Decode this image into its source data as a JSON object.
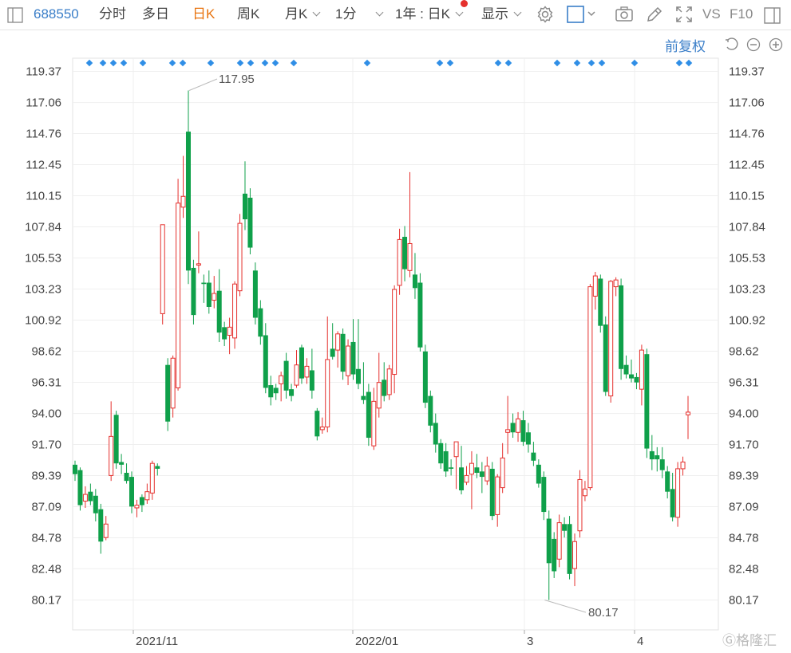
{
  "toolbar": {
    "stock_code": "688550",
    "tabs": [
      {
        "label": "分时"
      },
      {
        "label": "多日"
      },
      {
        "label": "日K",
        "active": true
      },
      {
        "label": "周K"
      },
      {
        "label": "月K"
      },
      {
        "label": "1分"
      }
    ],
    "period_select": "1年 : 日K",
    "display_label": "显示",
    "right_labels": [
      "VS",
      "F10"
    ],
    "accent_color": "#e8730e",
    "link_color": "#3a7ec8"
  },
  "subbar": {
    "fuquan_label": "前复权"
  },
  "watermark": "格隆汇",
  "chart_data": {
    "type": "candlestick",
    "yticks": [
      "119.37",
      "117.06",
      "114.76",
      "112.45",
      "110.15",
      "107.84",
      "105.53",
      "103.23",
      "100.92",
      "98.62",
      "96.31",
      "94.00",
      "91.70",
      "89.39",
      "87.09",
      "84.78",
      "82.48",
      "80.17"
    ],
    "ylim": [
      80.17,
      119.37
    ],
    "xlabels": [
      "2021/11",
      "2022/01",
      "3",
      "4"
    ],
    "high_annotation": "117.95",
    "low_annotation": "80.17",
    "up_color": "#e5302d",
    "down_color": "#0fa04a",
    "marker_color": "#2f8ee6",
    "candles": [
      [
        90.2,
        89.5,
        90.5,
        89.0
      ],
      [
        89.8,
        87.2,
        90.0,
        86.8
      ],
      [
        87.5,
        88.0,
        88.6,
        87.0
      ],
      [
        88.2,
        87.5,
        88.8,
        87.2
      ],
      [
        87.9,
        86.6,
        88.4,
        86.0
      ],
      [
        86.9,
        84.5,
        87.3,
        83.6
      ],
      [
        84.8,
        85.8,
        86.4,
        84.6
      ],
      [
        89.4,
        92.3,
        94.9,
        89.0
      ],
      [
        93.9,
        90.3,
        94.2,
        89.9
      ],
      [
        90.4,
        90.2,
        91.0,
        89.5
      ],
      [
        89.6,
        89.0,
        90.3,
        88.8
      ],
      [
        89.3,
        87.1,
        89.7,
        86.6
      ],
      [
        87.0,
        87.2,
        87.6,
        86.3
      ],
      [
        87.8,
        87.2,
        88.0,
        86.7
      ],
      [
        87.6,
        88.2,
        88.8,
        87.3
      ],
      [
        88.1,
        90.3,
        90.5,
        87.6
      ],
      [
        90.1,
        89.9,
        90.3,
        89.4
      ],
      [
        101.4,
        108.0,
        108.0,
        100.6
      ],
      [
        97.6,
        93.4,
        98.1,
        92.7
      ],
      [
        94.4,
        98.1,
        98.3,
        93.7
      ],
      [
        95.9,
        109.6,
        111.4,
        95.7
      ],
      [
        109.3,
        110.1,
        113.1,
        108.5
      ],
      [
        114.9,
        104.6,
        117.95,
        103.6
      ],
      [
        104.8,
        101.3,
        105.4,
        100.6
      ],
      [
        105.0,
        105.1,
        107.5,
        104.4
      ],
      [
        103.7,
        103.6,
        104.3,
        102.2
      ],
      [
        103.7,
        101.9,
        104.6,
        101.4
      ],
      [
        102.4,
        102.9,
        104.2,
        101.8
      ],
      [
        103.1,
        100.0,
        104.7,
        99.3
      ],
      [
        100.4,
        99.5,
        100.8,
        99.0
      ],
      [
        99.8,
        100.4,
        101.1,
        98.4
      ],
      [
        99.6,
        103.6,
        103.8,
        98.8
      ],
      [
        103.1,
        108.1,
        108.8,
        102.7
      ],
      [
        110.3,
        108.4,
        112.7,
        107.6
      ],
      [
        110.0,
        106.3,
        110.7,
        105.8
      ],
      [
        104.6,
        101.1,
        105.2,
        100.6
      ],
      [
        101.8,
        99.7,
        102.4,
        99.1
      ],
      [
        99.8,
        95.9,
        100.7,
        95.5
      ],
      [
        96.1,
        95.2,
        96.8,
        94.6
      ],
      [
        95.9,
        95.5,
        96.2,
        95.0
      ],
      [
        96.2,
        96.8,
        97.1,
        94.9
      ],
      [
        97.9,
        95.7,
        98.5,
        95.1
      ],
      [
        95.8,
        95.3,
        96.2,
        94.9
      ],
      [
        96.1,
        97.6,
        98.7,
        95.9
      ],
      [
        98.9,
        96.6,
        99.1,
        96.2
      ],
      [
        96.7,
        97.5,
        98.1,
        96.2
      ],
      [
        97.2,
        95.7,
        98.8,
        95.1
      ],
      [
        94.2,
        92.3,
        94.4,
        92.0
      ],
      [
        92.8,
        93.0,
        93.7,
        92.5
      ],
      [
        93.0,
        98.0,
        101.2,
        92.6
      ],
      [
        98.8,
        98.2,
        100.7,
        98.0
      ],
      [
        98.7,
        99.9,
        100.1,
        97.4
      ],
      [
        99.9,
        97.1,
        100.3,
        96.5
      ],
      [
        96.8,
        99.0,
        99.5,
        96.1
      ],
      [
        99.3,
        96.9,
        101.0,
        96.5
      ],
      [
        97.3,
        96.2,
        101.0,
        95.8
      ],
      [
        95.3,
        95.0,
        97.8,
        94.7
      ],
      [
        95.6,
        92.2,
        96.2,
        91.6
      ],
      [
        91.6,
        94.9,
        95.9,
        91.3
      ],
      [
        94.4,
        96.3,
        98.5,
        93.7
      ],
      [
        96.5,
        95.3,
        97.8,
        94.9
      ],
      [
        95.4,
        97.3,
        97.6,
        95.0
      ],
      [
        96.9,
        103.2,
        103.5,
        95.5
      ],
      [
        103.5,
        106.9,
        107.7,
        102.8
      ],
      [
        107.1,
        104.7,
        107.9,
        103.8
      ],
      [
        104.6,
        106.6,
        111.9,
        104.1
      ],
      [
        104.3,
        103.3,
        105.9,
        102.5
      ],
      [
        103.7,
        98.9,
        104.4,
        98.6
      ],
      [
        98.6,
        94.8,
        99.1,
        94.4
      ],
      [
        95.3,
        93.1,
        95.7,
        92.6
      ],
      [
        93.3,
        91.7,
        94.0,
        91.1
      ],
      [
        91.8,
        90.3,
        92.1,
        89.9
      ],
      [
        91.2,
        89.7,
        91.8,
        89.3
      ],
      [
        90.0,
        89.9,
        90.6,
        89.4
      ],
      [
        90.8,
        91.9,
        91.9,
        88.4
      ],
      [
        90.0,
        88.3,
        91.6,
        88.0
      ],
      [
        88.9,
        89.4,
        90.1,
        88.7
      ],
      [
        89.5,
        90.3,
        91.2,
        86.9
      ],
      [
        90.0,
        89.6,
        91.0,
        89.2
      ],
      [
        89.7,
        89.3,
        90.4,
        88.1
      ],
      [
        89.0,
        90.1,
        90.8,
        88.7
      ],
      [
        89.9,
        86.4,
        90.4,
        86.1
      ],
      [
        86.5,
        89.3,
        89.5,
        85.6
      ],
      [
        88.5,
        90.7,
        91.8,
        88.1
      ],
      [
        92.6,
        92.8,
        95.3,
        91.0
      ],
      [
        93.3,
        92.6,
        94.0,
        92.2
      ],
      [
        92.6,
        93.6,
        94.1,
        91.9
      ],
      [
        93.5,
        91.9,
        94.2,
        91.6
      ],
      [
        92.6,
        91.7,
        93.3,
        91.1
      ],
      [
        91.1,
        90.5,
        91.9,
        90.1
      ],
      [
        90.2,
        88.8,
        90.6,
        88.5
      ],
      [
        89.3,
        86.7,
        89.7,
        86.1
      ],
      [
        86.2,
        82.9,
        86.8,
        80.17
      ],
      [
        84.7,
        82.3,
        85.2,
        81.8
      ],
      [
        83.2,
        85.9,
        86.5,
        82.6
      ],
      [
        85.8,
        85.3,
        86.3,
        84.8
      ],
      [
        85.8,
        82.1,
        86.4,
        81.7
      ],
      [
        82.5,
        84.5,
        85.1,
        81.2
      ],
      [
        85.3,
        89.1,
        89.8,
        84.8
      ],
      [
        87.9,
        88.4,
        89.0,
        87.5
      ],
      [
        88.5,
        103.4,
        103.6,
        88.3
      ],
      [
        102.7,
        104.2,
        104.5,
        101.7
      ],
      [
        104.0,
        100.5,
        104.3,
        100.0
      ],
      [
        100.6,
        95.6,
        101.2,
        95.3
      ],
      [
        95.3,
        103.8,
        103.9,
        94.8
      ],
      [
        103.4,
        103.9,
        104.1,
        102.7
      ],
      [
        103.5,
        97.3,
        104.0,
        96.5
      ],
      [
        97.6,
        96.9,
        98.3,
        96.6
      ],
      [
        96.9,
        96.6,
        98.0,
        96.3
      ],
      [
        96.7,
        96.3,
        97.0,
        95.8
      ],
      [
        95.8,
        98.7,
        99.1,
        94.6
      ],
      [
        98.4,
        91.4,
        98.8,
        90.7
      ],
      [
        91.2,
        90.6,
        92.4,
        89.8
      ],
      [
        90.9,
        90.6,
        91.5,
        89.7
      ],
      [
        90.6,
        89.8,
        91.5,
        89.2
      ],
      [
        89.7,
        88.2,
        90.1,
        87.7
      ],
      [
        88.4,
        86.3,
        89.6,
        86.0
      ],
      [
        86.3,
        89.9,
        90.4,
        85.6
      ],
      [
        89.9,
        90.4,
        90.8,
        89.4
      ],
      [
        93.9,
        94.1,
        95.3,
        92.1
      ]
    ]
  }
}
